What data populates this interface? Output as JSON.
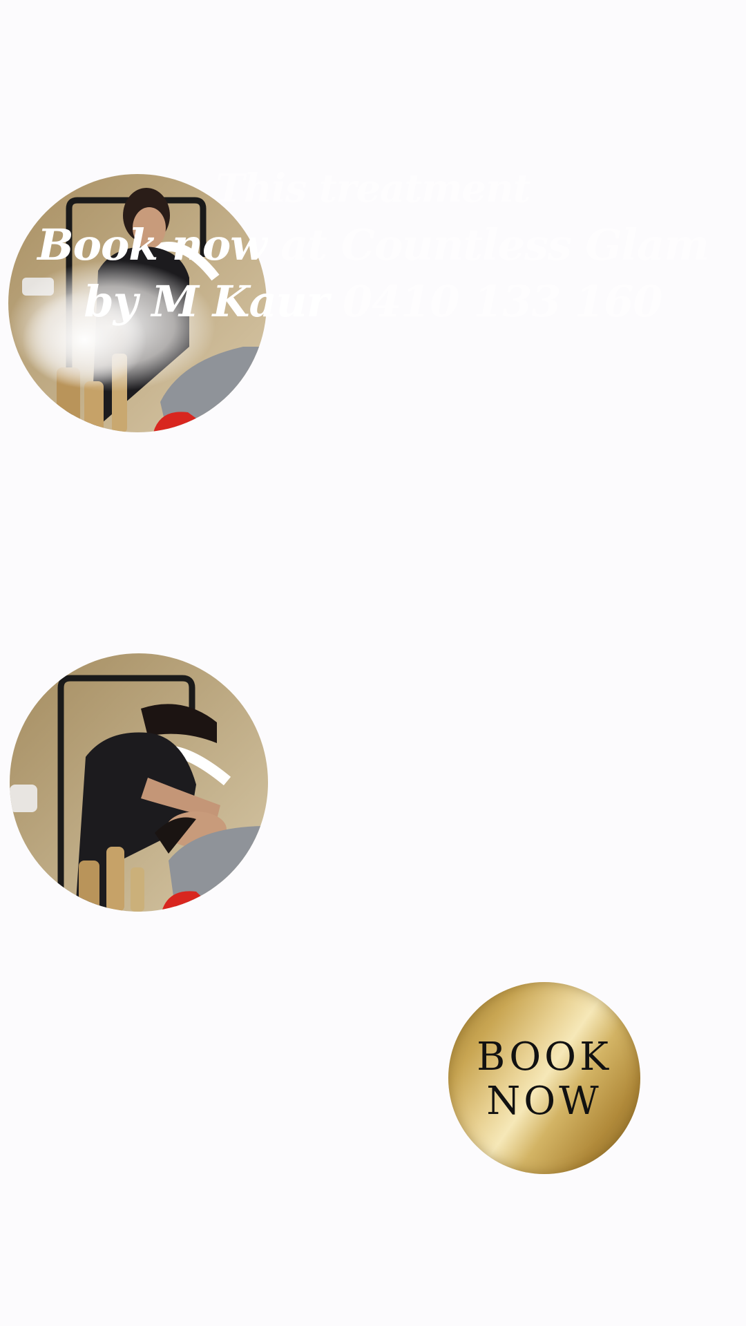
{
  "story": {
    "headline": {
      "line1": "This treatment",
      "line2_strong": "Book now",
      "line2_faint": " at Countless Glam",
      "line3_strong": "by M Kaur",
      "line3_faint": " 0410 133 160"
    },
    "book_now_sticker": {
      "line1": "BOOK",
      "line2": "NOW"
    }
  },
  "colors": {
    "background": "#fcfbfd",
    "gold": "#c9a653",
    "headline": "#ffffff",
    "salon_wall": "#b9a27a",
    "uniform": "#1c1b1e",
    "towel": "#8f9399",
    "bed_accent": "#d8261f"
  }
}
